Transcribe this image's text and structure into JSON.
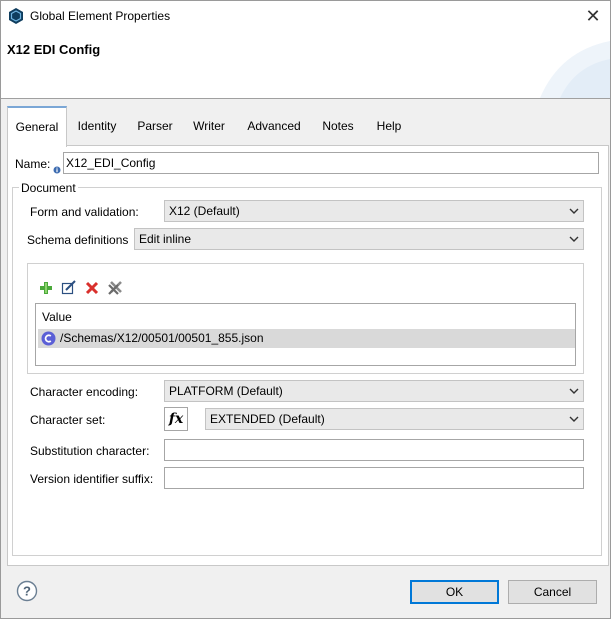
{
  "window": {
    "title": "Global Element Properties",
    "close_glyph": "✕",
    "app_icon": "mule-icon"
  },
  "header": {
    "heading": "X12 EDI Config"
  },
  "tabs": [
    {
      "label": "General",
      "active": true
    },
    {
      "label": "Identity"
    },
    {
      "label": "Parser"
    },
    {
      "label": "Writer"
    },
    {
      "label": "Advanced"
    },
    {
      "label": "Notes"
    },
    {
      "label": "Help"
    }
  ],
  "general": {
    "name_label": "Name:",
    "name_value": "X12_EDI_Config",
    "document_group": "Document",
    "form_validation_label": "Form and validation:",
    "form_validation_value": "X12 (Default)",
    "schema_definitions_label": "Schema definitions",
    "schema_definitions_value": "Edit inline",
    "schema_table": {
      "column": "Value",
      "rows": [
        "/Schemas/X12/00501/00501_855.json"
      ]
    },
    "toolbar_icons": [
      "add-icon",
      "edit-icon",
      "delete-icon",
      "delete-all-icon"
    ],
    "character_encoding_label": "Character encoding:",
    "character_encoding_value": "PLATFORM (Default)",
    "character_set_label": "Character set:",
    "character_set_value": "EXTENDED (Default)",
    "fx_label": "fx",
    "substitution_label": "Substitution character:",
    "substitution_value": "",
    "version_suffix_label": "Version identifier suffix:",
    "version_suffix_value": ""
  },
  "footer": {
    "help_glyph": "?",
    "ok_label": "OK",
    "cancel_label": "Cancel"
  },
  "colors": {
    "accent": "#0078d7",
    "tab_highlight": "#7ba7d6",
    "selected_row": "#d9d9d9"
  }
}
